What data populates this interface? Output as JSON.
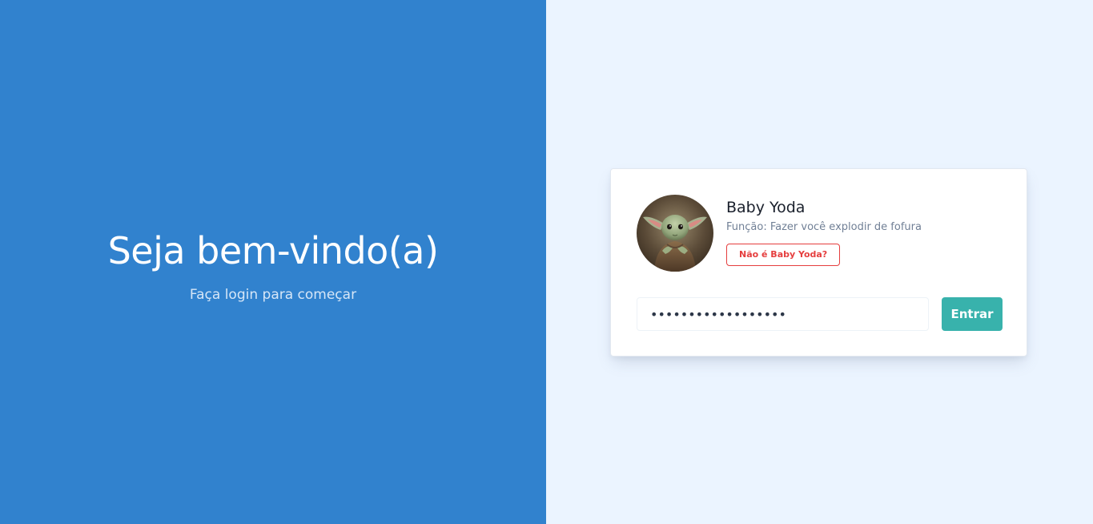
{
  "welcome": {
    "title": "Seja bem-vindo(a)",
    "subtitle": "Faça login para começar"
  },
  "profile": {
    "avatar_icon": "baby-yoda-avatar",
    "name": "Baby Yoda",
    "role": "Função: Fazer você explodir de fofura",
    "not_user_label": "Não é Baby Yoda?"
  },
  "login": {
    "password_value": "••••••••••••••••••",
    "submit_label": "Entrar"
  },
  "colors": {
    "left_background": "#3182ce",
    "right_background": "#ebf4ff",
    "submit_button": "#38b2ac",
    "not_user_accent": "#e53e3e"
  }
}
